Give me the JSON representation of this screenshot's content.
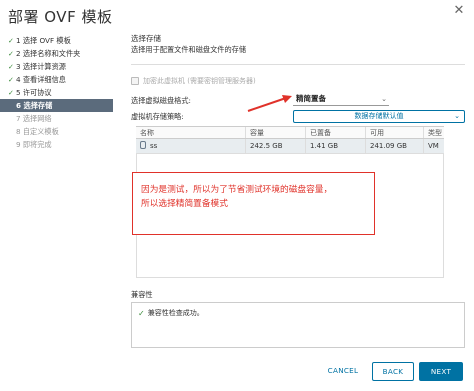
{
  "wizard": {
    "title": "部署 OVF 模板"
  },
  "steps": [
    {
      "label": "1 选择 OVF 模板",
      "state": "done"
    },
    {
      "label": "2 选择名称和文件夹",
      "state": "done"
    },
    {
      "label": "3 选择计算资源",
      "state": "done"
    },
    {
      "label": "4 查看详细信息",
      "state": "done"
    },
    {
      "label": "5 许可协议",
      "state": "done"
    },
    {
      "label": "6 选择存储",
      "state": "active"
    },
    {
      "label": "7 选择网络",
      "state": "disabled"
    },
    {
      "label": "8 自定义模板",
      "state": "disabled"
    },
    {
      "label": "9 即将完成",
      "state": "disabled"
    }
  ],
  "main": {
    "title": "选择存储",
    "description": "选择用于配置文件和磁盘文件的存储",
    "encrypt_checkbox_label": "加密此虚拟机 (需要密钥管理服务器)",
    "disk_format_label": "选择虚拟磁盘格式:",
    "disk_format_value": "精简置备",
    "vm_storage_policy_label": "虚拟机存储策略:",
    "vm_storage_policy_value": "数据存储默认值"
  },
  "table": {
    "headers": [
      "名称",
      "容量",
      "已置备",
      "可用",
      "类型"
    ],
    "rows": [
      {
        "name": "ss",
        "capacity": "242.5 GB",
        "provisioned": "1.41 GB",
        "free": "241.09 GB",
        "type": "VM"
      }
    ]
  },
  "annotation": {
    "line1": "因为是测试，所以为了节省测试环境的磁盘容量，",
    "line2": "所以选择精简置备模式"
  },
  "compatibility": {
    "label": "兼容性",
    "status": "兼容性检查成功。"
  },
  "buttons": {
    "cancel": "CANCEL",
    "back": "BACK",
    "next": "NEXT"
  },
  "colors": {
    "accent": "#0072a3",
    "annotation": "#e0322a",
    "active_step": "#5b6b7c",
    "success": "#3c8c3c"
  }
}
